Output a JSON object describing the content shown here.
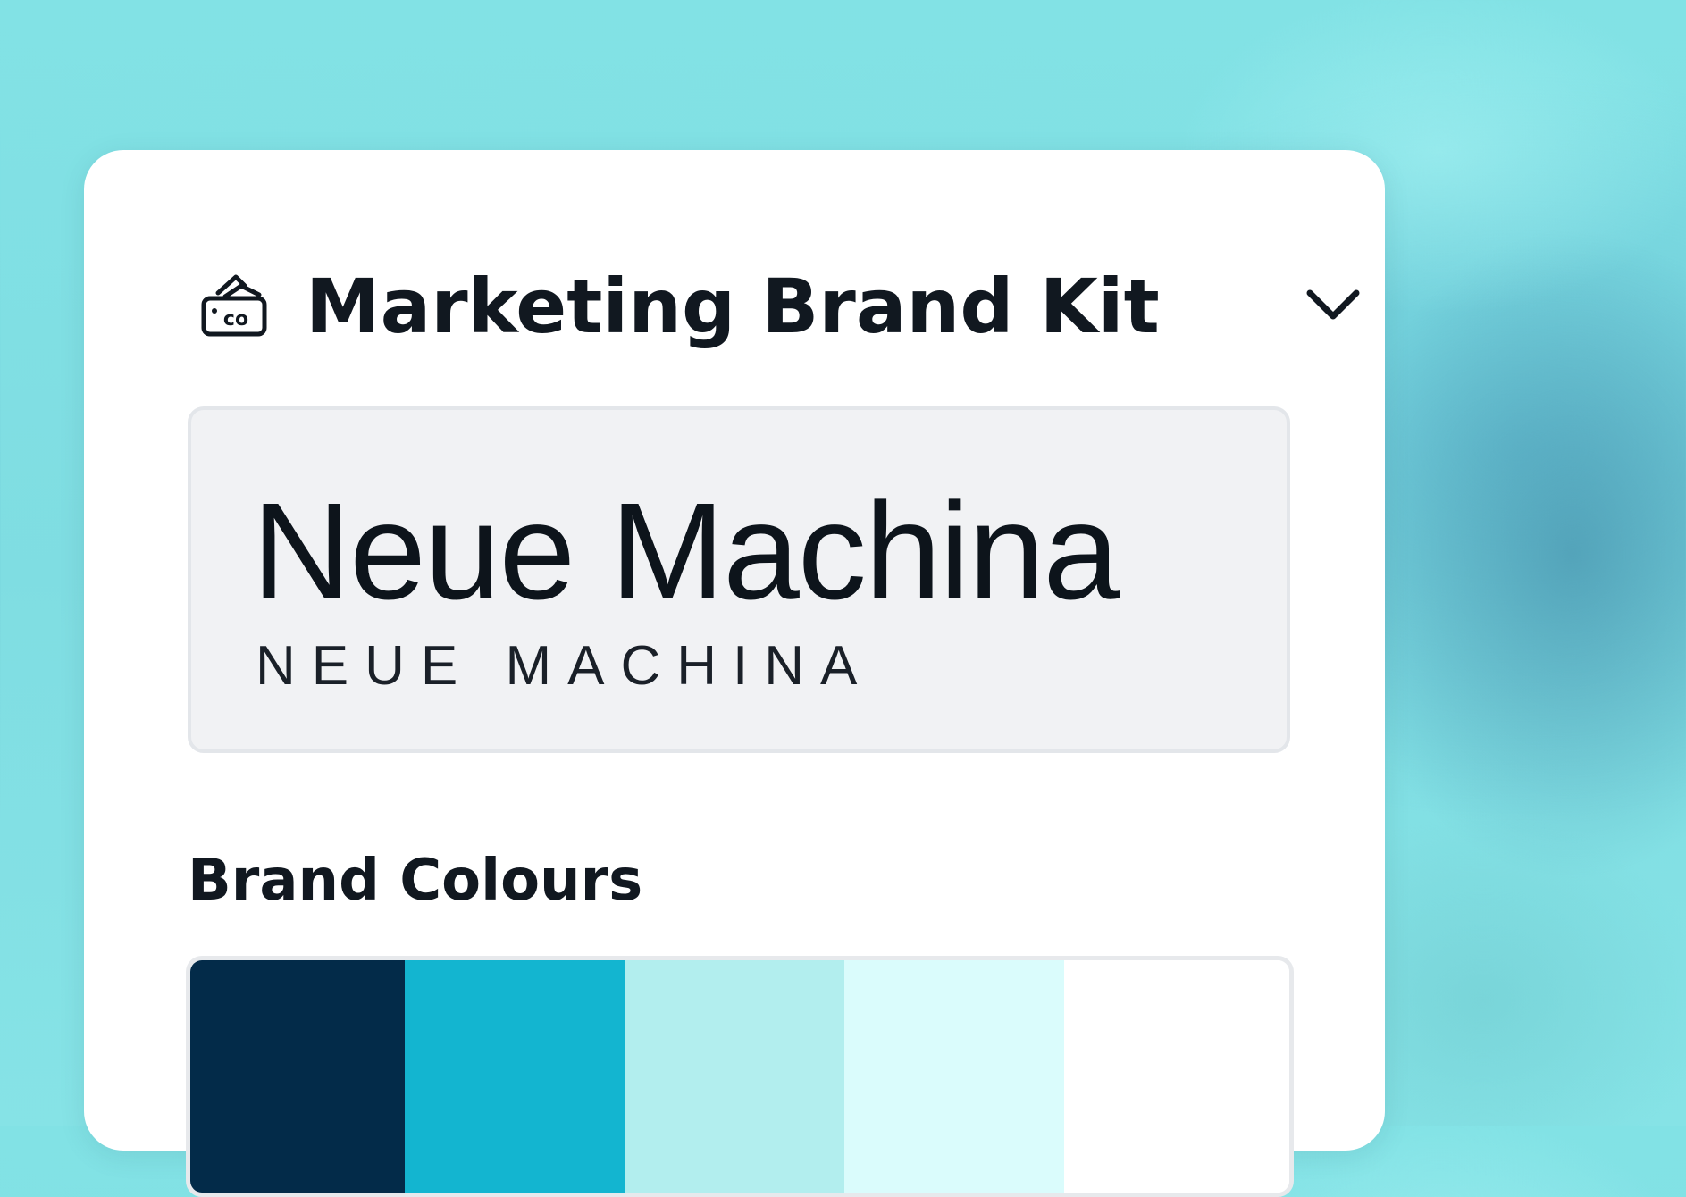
{
  "brand_kit": {
    "title": "Marketing Brand Kit",
    "icon": "brand-kit-icon",
    "icon_text": "co",
    "dropdown_icon": "chevron-down-icon"
  },
  "font": {
    "name": "Neue Machina",
    "name_upper": "NEUE MACHINA"
  },
  "colours": {
    "title": "Brand Colours",
    "swatches": [
      "#032b49",
      "#13b5d0",
      "#b2eeee",
      "#dafcfc",
      "#ffffff"
    ]
  }
}
